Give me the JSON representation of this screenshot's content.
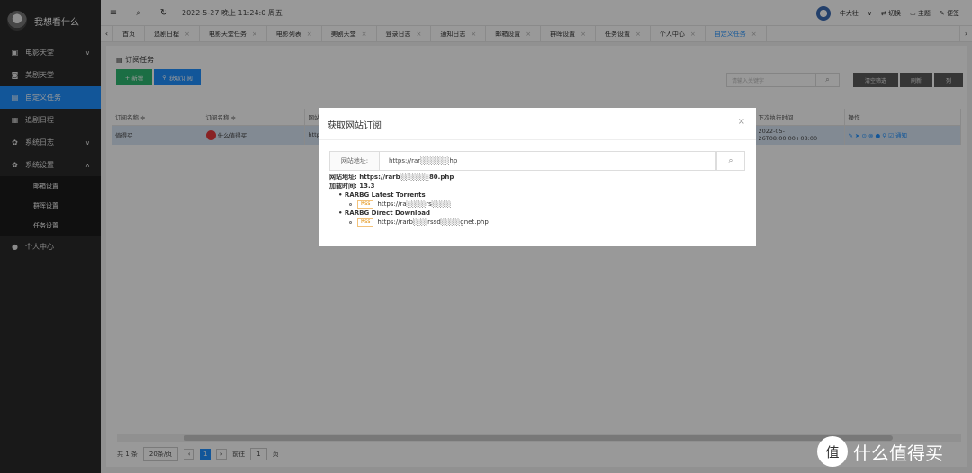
{
  "app": {
    "title": "我想看什么"
  },
  "sidebar": {
    "items": [
      {
        "label": "电影天堂",
        "icon": "film-icon",
        "chev": "∨"
      },
      {
        "label": "美剧天堂",
        "icon": "tv-icon"
      },
      {
        "label": "自定义任务",
        "icon": "task-icon",
        "active": true
      },
      {
        "label": "追剧日程",
        "icon": "calendar-icon"
      },
      {
        "label": "系统日志",
        "icon": "gear-icon",
        "chev": "∨"
      },
      {
        "label": "系统设置",
        "icon": "gear-icon",
        "chev": "∧"
      }
    ],
    "subitems": [
      "邮箱设置",
      "群晖设置",
      "任务设置"
    ],
    "bottom_item": {
      "label": "个人中心",
      "icon": "user-icon"
    }
  },
  "topbar": {
    "datetime": "2022-5-27 晚上 11:24:0 周五",
    "user": "牛大壮",
    "switch_label": "切换",
    "theme_label": "主题",
    "note_label": "便签"
  },
  "tabs": [
    "首页",
    "追剧日程",
    "电影天堂任务",
    "电影列表",
    "美剧天堂",
    "登录日志",
    "通知日志",
    "邮箱设置",
    "群晖设置",
    "任务设置",
    "个人中心",
    "自定义任务"
  ],
  "main": {
    "panel_title": "订阅任务",
    "add_label": "+ 新增",
    "fetch_label": "获取订阅",
    "search_placeholder": "请输入关键字",
    "clear_label": "清空筛选",
    "refresh_label": "刷新",
    "columns_label": "列",
    "table": {
      "headers": [
        "订阅名称 ≑",
        "订阅名称 ≑",
        "网站",
        "下次执行时间",
        "操作"
      ],
      "row": [
        "值得买",
        "什么值得买",
        "http:/",
        "2022-05-26T08:00:00+08:00",
        "通知"
      ]
    },
    "pager": {
      "total": "共 1 条",
      "per_page": "20条/页",
      "current": "1",
      "goto_label": "前往",
      "goto_value": "1",
      "page_label": "页"
    }
  },
  "modal": {
    "title": "获取网站订阅",
    "close": "×",
    "label": "网站地址:",
    "url_value": "https://rar░░░░░░hp",
    "site_line": "网站地址: https://rarb░░░░░░80.php",
    "time_line": "加载时间: 13.3",
    "feeds": [
      {
        "name": "RARBG Latest Torrents",
        "badge": "Rss",
        "url": "https://ra░░░░rs░░░░"
      },
      {
        "name": "RARBG Direct Download",
        "badge": "Rss",
        "url": "https://rarb░░░rssd░░░░gnet.php"
      }
    ]
  },
  "watermark": {
    "text": "什么值得买",
    "logo": "值"
  }
}
